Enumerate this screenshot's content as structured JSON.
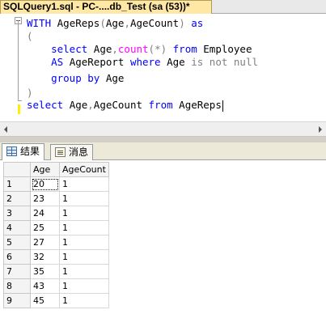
{
  "document_tab": {
    "title": "SQLQuery1.sql - PC-....db_Test (sa (53))*"
  },
  "editor": {
    "lines": [
      [
        {
          "t": "WITH ",
          "c": "kw"
        },
        {
          "t": "AgeReps",
          "c": "id"
        },
        {
          "t": "(",
          "c": "op"
        },
        {
          "t": "Age",
          "c": "id"
        },
        {
          "t": ",",
          "c": "op"
        },
        {
          "t": "AgeCount",
          "c": "id"
        },
        {
          "t": ")",
          "c": "op"
        },
        {
          "t": " ",
          "c": "id"
        },
        {
          "t": "as",
          "c": "kw"
        }
      ],
      [
        {
          "t": "(",
          "c": "op"
        }
      ],
      [
        {
          "t": "    select ",
          "c": "kw"
        },
        {
          "t": "Age",
          "c": "id"
        },
        {
          "t": ",",
          "c": "op"
        },
        {
          "t": "count",
          "c": "fn"
        },
        {
          "t": "(*)",
          "c": "op"
        },
        {
          "t": " from ",
          "c": "kw"
        },
        {
          "t": "Employee",
          "c": "id"
        }
      ],
      [
        {
          "t": "    AS ",
          "c": "kw"
        },
        {
          "t": "AgeReport ",
          "c": "id"
        },
        {
          "t": "where ",
          "c": "kw"
        },
        {
          "t": "Age ",
          "c": "id"
        },
        {
          "t": "is not null",
          "c": "op"
        }
      ],
      [
        {
          "t": "    group by ",
          "c": "kw"
        },
        {
          "t": "Age",
          "c": "id"
        }
      ],
      [
        {
          "t": ")",
          "c": "op"
        }
      ],
      [
        {
          "t": "select ",
          "c": "kw"
        },
        {
          "t": "Age",
          "c": "id"
        },
        {
          "t": ",",
          "c": "op"
        },
        {
          "t": "AgeCount ",
          "c": "id"
        },
        {
          "t": "from ",
          "c": "kw"
        },
        {
          "t": "AgeReps",
          "c": "id"
        }
      ]
    ]
  },
  "result_tabs": [
    {
      "label": "结果",
      "icon": "grid-icon",
      "active": true
    },
    {
      "label": "消息",
      "icon": "messages-icon",
      "active": false
    }
  ],
  "results_grid": {
    "columns": [
      "Age",
      "AgeCount"
    ],
    "rows": [
      {
        "n": "1",
        "age": "20",
        "count": "1"
      },
      {
        "n": "2",
        "age": "23",
        "count": "1"
      },
      {
        "n": "3",
        "age": "24",
        "count": "1"
      },
      {
        "n": "4",
        "age": "25",
        "count": "1"
      },
      {
        "n": "5",
        "age": "27",
        "count": "1"
      },
      {
        "n": "6",
        "age": "32",
        "count": "1"
      },
      {
        "n": "7",
        "age": "35",
        "count": "1"
      },
      {
        "n": "8",
        "age": "43",
        "count": "1"
      },
      {
        "n": "9",
        "age": "45",
        "count": "1"
      }
    ]
  },
  "colors": {
    "keyword": "#0000ff",
    "function": "#ff00ff",
    "operator": "#808080",
    "tab_active": "#ffe8a6"
  }
}
